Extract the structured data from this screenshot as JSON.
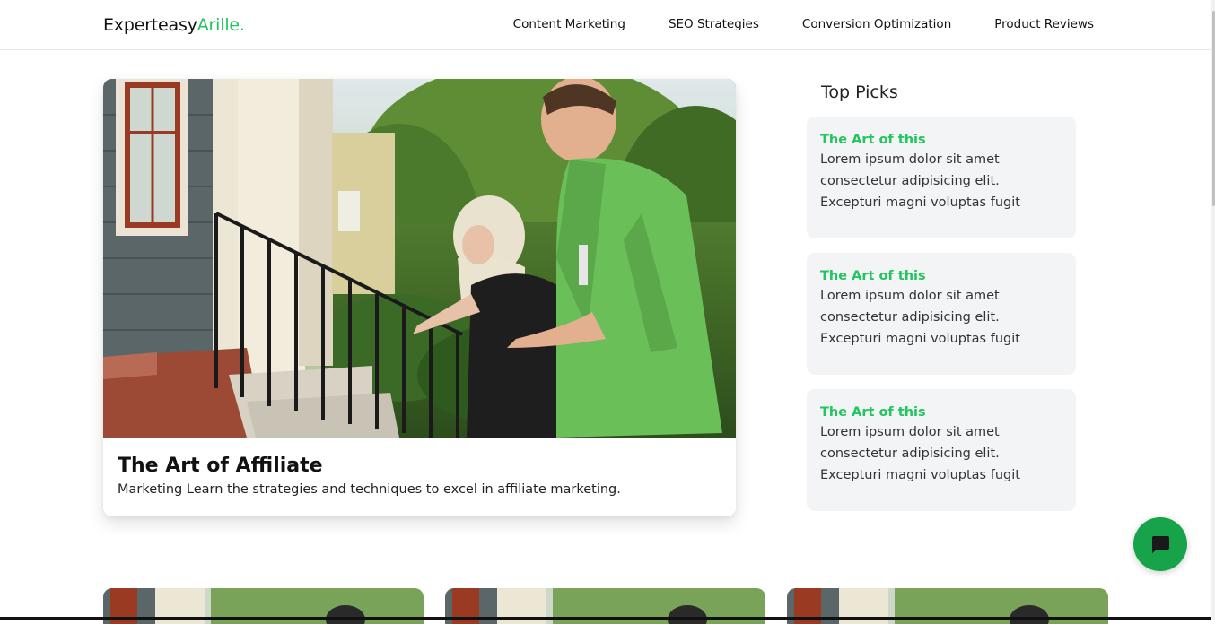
{
  "header": {
    "logo_main": "Experteasy",
    "logo_accent": "Arille.",
    "nav": [
      {
        "label": "Content Marketing"
      },
      {
        "label": "SEO Strategies"
      },
      {
        "label": "Conversion Optimization"
      },
      {
        "label": "Product Reviews"
      }
    ]
  },
  "hero": {
    "title": "The Art of Affiliate",
    "description": "Marketing Learn the strategies and techniques to excel in affiliate marketing."
  },
  "sidebar": {
    "title": "Top Picks",
    "items": [
      {
        "title": "The Art of this",
        "text": "Lorem ipsum dolor sit amet consectetur adipisicing elit. Excepturi magni voluptas fugit"
      },
      {
        "title": "The Art of this",
        "text": "Lorem ipsum dolor sit amet consectetur adipisicing elit. Excepturi magni voluptas fugit"
      },
      {
        "title": "The Art of this",
        "text": "Lorem ipsum dolor sit amet consectetur adipisicing elit. Excepturi magni voluptas fugit"
      }
    ]
  },
  "colors": {
    "accent": "#22c55e",
    "chat_button": "#16a34a",
    "card_bg": "#f3f4f6"
  },
  "icons": {
    "chat": "chat-bubble-icon"
  }
}
